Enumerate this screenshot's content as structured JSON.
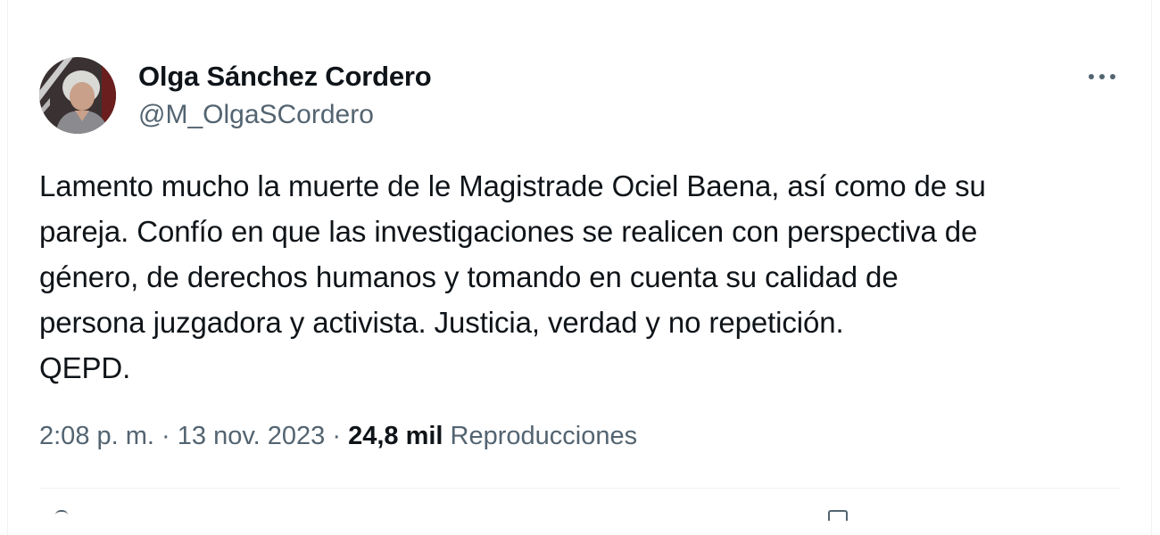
{
  "author": {
    "display_name": "Olga Sánchez Cordero",
    "handle": "@M_OlgaSCordero"
  },
  "tweet": {
    "lines": [
      "Lamento mucho la muerte de le Magistrade Ociel Baena, así como de su",
      "pareja. Confío en que las investigaciones se realicen con perspectiva de",
      "género, de derechos humanos y tomando en cuenta su calidad de",
      "persona juzgadora y activista. Justicia, verdad y no repetición.",
      "QEPD."
    ]
  },
  "meta": {
    "time": "2:08 p. m.",
    "separator_1": " · ",
    "date": "13 nov. 2023",
    "separator_2": " · ",
    "views_count": "24,8 mil",
    "views_label": "Reproducciones"
  },
  "icons": {
    "more": "more-options-icon",
    "avatar": "avatar"
  },
  "colors": {
    "text_primary": "#0f1419",
    "text_secondary": "#536471",
    "divider": "#eff3f4"
  }
}
